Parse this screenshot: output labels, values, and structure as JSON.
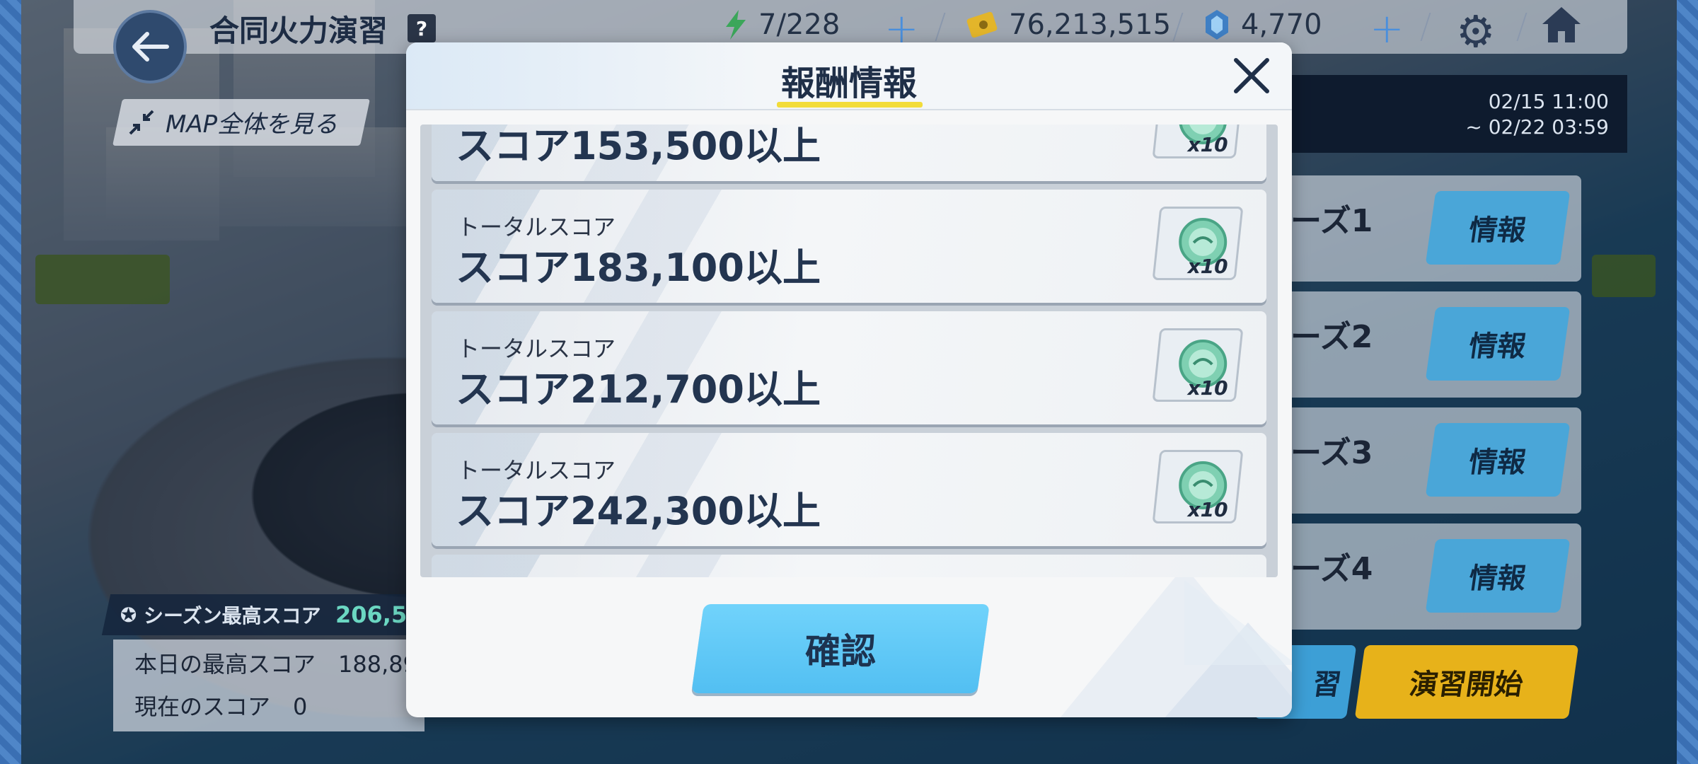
{
  "header": {
    "title": "合同火力演習",
    "help_label": "?",
    "energy": "7/228",
    "credits": "76,213,515",
    "gems": "4,770",
    "plus": "+"
  },
  "map_button_label": "MAP全体を見る",
  "period": {
    "start": "02/15 11:00",
    "end": "~ 02/22 03:59"
  },
  "seasons": [
    {
      "label": "ーズ1",
      "info": "情報"
    },
    {
      "label": "ーズ2",
      "info": "情報"
    },
    {
      "label": "ーズ3",
      "info": "情報"
    },
    {
      "label": "ーズ4",
      "info": "情報"
    }
  ],
  "practice_label": "習",
  "start_label": "演習開始",
  "season_best": {
    "label": "シーズン最高スコア",
    "value": "206,5"
  },
  "today_best": "本日の最高スコア　188,89",
  "current_score": "現在のスコア　0",
  "modal": {
    "title": "報酬情報",
    "confirm_label": "確認",
    "rewards": [
      {
        "sub": "",
        "main": "スコア153,500以上",
        "qty": "x10"
      },
      {
        "sub": "トータルスコア",
        "main": "スコア183,100以上",
        "qty": "x10"
      },
      {
        "sub": "トータルスコア",
        "main": "スコア212,700以上",
        "qty": "x10"
      },
      {
        "sub": "トータルスコア",
        "main": "スコア242,300以上",
        "qty": "x10"
      }
    ]
  },
  "colors": {
    "accent_blue": "#52bff2",
    "title_underline": "#f2dc3a",
    "start_yellow": "#e7b21a"
  },
  "icons": [
    "back-arrow-icon",
    "energy-bolt-icon",
    "credit-card-icon",
    "gem-icon",
    "gear-icon",
    "home-icon",
    "close-icon",
    "shrink-arrows-icon",
    "medal-icon",
    "coin-icon"
  ]
}
